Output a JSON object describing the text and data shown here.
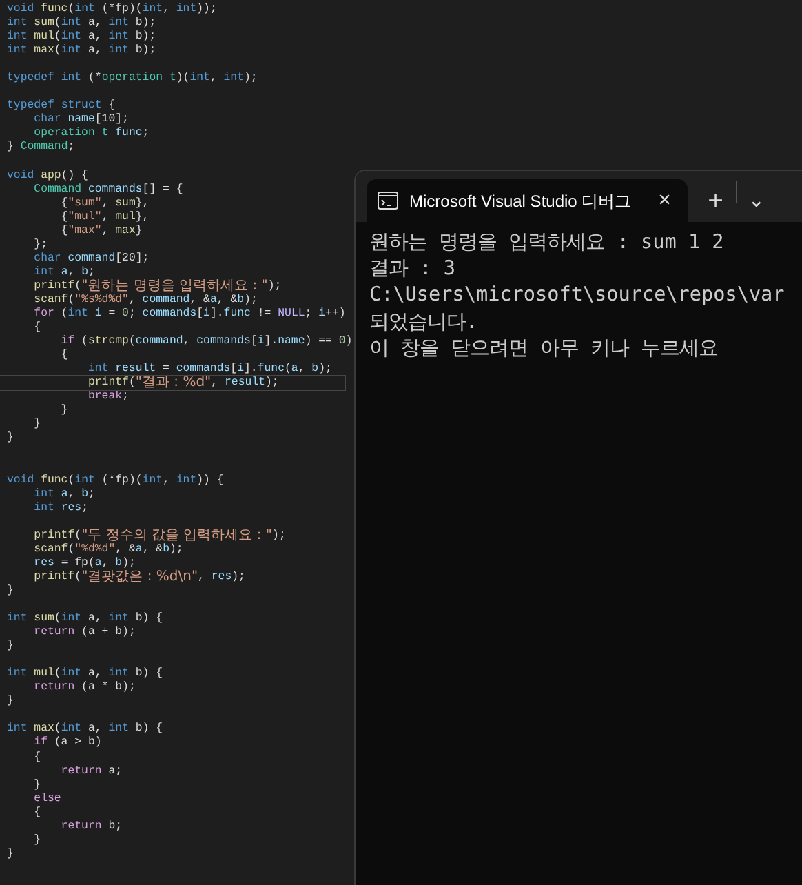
{
  "editor": {
    "code_lines": [
      {
        "current": false,
        "segments": [
          {
            "text": "void",
            "kind": "keyword"
          },
          {
            "text": " func",
            "kind": "function"
          },
          {
            "text": "(",
            "kind": "plain"
          },
          {
            "text": "int",
            "kind": "keyword"
          },
          {
            "text": " (*fp)(",
            "kind": "plain"
          },
          {
            "text": "int",
            "kind": "keyword"
          },
          {
            "text": ",",
            "kind": "plain"
          },
          {
            "text": " int",
            "kind": "keyword"
          },
          {
            "text": "));",
            "kind": "plain"
          }
        ]
      },
      {
        "current": false,
        "segments": [
          {
            "text": "int",
            "kind": "keyword"
          },
          {
            "text": " sum",
            "kind": "function"
          },
          {
            "text": "(",
            "kind": "plain"
          },
          {
            "text": "int",
            "kind": "keyword"
          },
          {
            "text": " a,",
            "kind": "plain"
          },
          {
            "text": " int",
            "kind": "keyword"
          },
          {
            "text": " b);",
            "kind": "plain"
          }
        ]
      },
      {
        "current": false,
        "segments": [
          {
            "text": "int",
            "kind": "keyword"
          },
          {
            "text": " mul",
            "kind": "function"
          },
          {
            "text": "(",
            "kind": "plain"
          },
          {
            "text": "int",
            "kind": "keyword"
          },
          {
            "text": " a,",
            "kind": "plain"
          },
          {
            "text": " int",
            "kind": "keyword"
          },
          {
            "text": " b);",
            "kind": "plain"
          }
        ]
      },
      {
        "current": false,
        "segments": [
          {
            "text": "int",
            "kind": "keyword"
          },
          {
            "text": " max",
            "kind": "function"
          },
          {
            "text": "(",
            "kind": "plain"
          },
          {
            "text": "int",
            "kind": "keyword"
          },
          {
            "text": " a,",
            "kind": "plain"
          },
          {
            "text": " int",
            "kind": "keyword"
          },
          {
            "text": " b);",
            "kind": "plain"
          }
        ]
      },
      {
        "current": false
      },
      {
        "current": false,
        "segments": [
          {
            "text": "typedef",
            "kind": "keyword"
          },
          {
            "text": " int",
            "kind": "keyword"
          },
          {
            "text": " (*",
            "kind": "plain"
          },
          {
            "text": "operation_t",
            "kind": "type"
          },
          {
            "text": ")(",
            "kind": "plain"
          },
          {
            "text": "int",
            "kind": "keyword"
          },
          {
            "text": ",",
            "kind": "plain"
          },
          {
            "text": " int",
            "kind": "keyword"
          },
          {
            "text": ");",
            "kind": "plain"
          }
        ]
      },
      {
        "current": false
      },
      {
        "current": false,
        "segments": [
          {
            "text": "typedef",
            "kind": "keyword"
          },
          {
            "text": " struct",
            "kind": "keyword"
          },
          {
            "text": " {",
            "kind": "plain"
          }
        ]
      },
      {
        "current": false,
        "segments": [
          {
            "text": "    char",
            "kind": "keyword"
          },
          {
            "text": " name",
            "kind": "variable"
          },
          {
            "text": "[10];",
            "kind": "plain"
          }
        ]
      },
      {
        "current": false,
        "segments": [
          {
            "text": "    operation_t",
            "kind": "type"
          },
          {
            "text": " func",
            "kind": "variable"
          },
          {
            "text": ";",
            "kind": "plain"
          }
        ]
      },
      {
        "current": false,
        "segments": [
          {
            "text": "}",
            "kind": "plain"
          },
          {
            "text": " Command",
            "kind": "type"
          },
          {
            "text": ";",
            "kind": "plain"
          }
        ]
      },
      {
        "current": false
      },
      {
        "current": false,
        "segments": [
          {
            "text": "void",
            "kind": "keyword"
          },
          {
            "text": " app",
            "kind": "function"
          },
          {
            "text": "() {",
            "kind": "plain"
          }
        ]
      },
      {
        "current": false,
        "segments": [
          {
            "text": "    Command",
            "kind": "type"
          },
          {
            "text": " commands",
            "kind": "variable"
          },
          {
            "text": "[] = {",
            "kind": "plain"
          }
        ]
      },
      {
        "current": false,
        "segments": [
          {
            "text": "        {",
            "kind": "plain"
          },
          {
            "text": "\"sum\"",
            "kind": "string"
          },
          {
            "text": ",",
            "kind": "plain"
          },
          {
            "text": " sum",
            "kind": "function"
          },
          {
            "text": "},",
            "kind": "plain"
          }
        ]
      },
      {
        "current": false,
        "segments": [
          {
            "text": "        {",
            "kind": "plain"
          },
          {
            "text": "\"mul\"",
            "kind": "string"
          },
          {
            "text": ",",
            "kind": "plain"
          },
          {
            "text": " mul",
            "kind": "function"
          },
          {
            "text": "},",
            "kind": "plain"
          }
        ]
      },
      {
        "current": false,
        "segments": [
          {
            "text": "        {",
            "kind": "plain"
          },
          {
            "text": "\"max\"",
            "kind": "string"
          },
          {
            "text": ",",
            "kind": "plain"
          },
          {
            "text": " max",
            "kind": "function"
          },
          {
            "text": "}",
            "kind": "plain"
          }
        ]
      },
      {
        "current": false,
        "segments": [
          {
            "text": "    };",
            "kind": "plain"
          }
        ]
      },
      {
        "current": false,
        "segments": [
          {
            "text": "    char",
            "kind": "keyword"
          },
          {
            "text": " command",
            "kind": "variable"
          },
          {
            "text": "[20];",
            "kind": "plain"
          }
        ]
      },
      {
        "current": false,
        "segments": [
          {
            "text": "    int",
            "kind": "keyword"
          },
          {
            "text": " a",
            "kind": "variable"
          },
          {
            "text": ",",
            "kind": "plain"
          },
          {
            "text": " b",
            "kind": "variable"
          },
          {
            "text": ";",
            "kind": "plain"
          }
        ]
      },
      {
        "current": false,
        "segments": [
          {
            "text": "    printf",
            "kind": "function"
          },
          {
            "text": "(",
            "kind": "plain"
          },
          {
            "text": "\"원하는 명령을 입력하세요 : \"",
            "kind": "string"
          },
          {
            "text": ");",
            "kind": "plain"
          }
        ]
      },
      {
        "current": false,
        "segments": [
          {
            "text": "    scanf",
            "kind": "function"
          },
          {
            "text": "(",
            "kind": "plain"
          },
          {
            "text": "\"%s%d%d\"",
            "kind": "string"
          },
          {
            "text": ",",
            "kind": "plain"
          },
          {
            "text": " command",
            "kind": "variable"
          },
          {
            "text": ", &",
            "kind": "plain"
          },
          {
            "text": "a",
            "kind": "variable"
          },
          {
            "text": ", &",
            "kind": "plain"
          },
          {
            "text": "b",
            "kind": "variable"
          },
          {
            "text": ");",
            "kind": "plain"
          }
        ]
      },
      {
        "current": false,
        "segments": [
          {
            "text": "    for",
            "kind": "control"
          },
          {
            "text": " (",
            "kind": "plain"
          },
          {
            "text": "int",
            "kind": "keyword"
          },
          {
            "text": " i",
            "kind": "variable"
          },
          {
            "text": " =",
            "kind": "plain"
          },
          {
            "text": " 0",
            "kind": "number"
          },
          {
            "text": ";",
            "kind": "plain"
          },
          {
            "text": " commands",
            "kind": "variable"
          },
          {
            "text": "[",
            "kind": "plain"
          },
          {
            "text": "i",
            "kind": "variable"
          },
          {
            "text": "].",
            "kind": "plain"
          },
          {
            "text": "func",
            "kind": "variable"
          },
          {
            "text": " !=",
            "kind": "plain"
          },
          {
            "text": " NULL",
            "kind": "macro"
          },
          {
            "text": ";",
            "kind": "plain"
          },
          {
            "text": " i",
            "kind": "variable"
          },
          {
            "text": "++)",
            "kind": "plain"
          }
        ]
      },
      {
        "current": false,
        "segments": [
          {
            "text": "    {",
            "kind": "plain"
          }
        ]
      },
      {
        "current": false,
        "segments": [
          {
            "text": "        if",
            "kind": "control"
          },
          {
            "text": " (",
            "kind": "plain"
          },
          {
            "text": "strcmp",
            "kind": "function"
          },
          {
            "text": "(",
            "kind": "plain"
          },
          {
            "text": "command",
            "kind": "variable"
          },
          {
            "text": ",",
            "kind": "plain"
          },
          {
            "text": " commands",
            "kind": "variable"
          },
          {
            "text": "[",
            "kind": "plain"
          },
          {
            "text": "i",
            "kind": "variable"
          },
          {
            "text": "].",
            "kind": "plain"
          },
          {
            "text": "name",
            "kind": "variable"
          },
          {
            "text": ") ==",
            "kind": "plain"
          },
          {
            "text": " 0",
            "kind": "number"
          },
          {
            "text": ")",
            "kind": "plain"
          }
        ]
      },
      {
        "current": false,
        "segments": [
          {
            "text": "        {",
            "kind": "plain"
          }
        ]
      },
      {
        "current": false,
        "segments": [
          {
            "text": "            int",
            "kind": "keyword"
          },
          {
            "text": " result",
            "kind": "variable"
          },
          {
            "text": " =",
            "kind": "plain"
          },
          {
            "text": " commands",
            "kind": "variable"
          },
          {
            "text": "[",
            "kind": "plain"
          },
          {
            "text": "i",
            "kind": "variable"
          },
          {
            "text": "].",
            "kind": "plain"
          },
          {
            "text": "func",
            "kind": "variable"
          },
          {
            "text": "(",
            "kind": "plain"
          },
          {
            "text": "a",
            "kind": "variable"
          },
          {
            "text": ",",
            "kind": "plain"
          },
          {
            "text": " b",
            "kind": "variable"
          },
          {
            "text": ");",
            "kind": "plain"
          }
        ]
      },
      {
        "current": true,
        "segments": [
          {
            "text": "            printf",
            "kind": "function"
          },
          {
            "text": "(",
            "kind": "plain"
          },
          {
            "text": "\"결과 : %d\"",
            "kind": "string"
          },
          {
            "text": ",",
            "kind": "plain"
          },
          {
            "text": " result",
            "kind": "variable"
          },
          {
            "text": ");",
            "kind": "plain"
          }
        ]
      },
      {
        "current": false,
        "segments": [
          {
            "text": "            break",
            "kind": "control"
          },
          {
            "text": ";",
            "kind": "plain"
          }
        ]
      },
      {
        "current": false,
        "segments": [
          {
            "text": "        }",
            "kind": "plain"
          }
        ]
      },
      {
        "current": false,
        "segments": [
          {
            "text": "    }",
            "kind": "plain"
          }
        ]
      },
      {
        "current": false,
        "segments": [
          {
            "text": "}",
            "kind": "plain"
          }
        ]
      },
      {
        "current": false
      },
      {
        "current": false
      },
      {
        "current": false,
        "segments": [
          {
            "text": "void",
            "kind": "keyword"
          },
          {
            "text": " func",
            "kind": "function"
          },
          {
            "text": "(",
            "kind": "plain"
          },
          {
            "text": "int",
            "kind": "keyword"
          },
          {
            "text": " (*fp)(",
            "kind": "plain"
          },
          {
            "text": "int",
            "kind": "keyword"
          },
          {
            "text": ",",
            "kind": "plain"
          },
          {
            "text": " int",
            "kind": "keyword"
          },
          {
            "text": ")) {",
            "kind": "plain"
          }
        ]
      },
      {
        "current": false,
        "segments": [
          {
            "text": "    int",
            "kind": "keyword"
          },
          {
            "text": " a",
            "kind": "variable"
          },
          {
            "text": ",",
            "kind": "plain"
          },
          {
            "text": " b",
            "kind": "variable"
          },
          {
            "text": ";",
            "kind": "plain"
          }
        ]
      },
      {
        "current": false,
        "segments": [
          {
            "text": "    int",
            "kind": "keyword"
          },
          {
            "text": " res",
            "kind": "variable"
          },
          {
            "text": ";",
            "kind": "plain"
          }
        ]
      },
      {
        "current": false
      },
      {
        "current": false,
        "segments": [
          {
            "text": "    printf",
            "kind": "function"
          },
          {
            "text": "(",
            "kind": "plain"
          },
          {
            "text": "\"두 정수의 값을 입력하세요 : \"",
            "kind": "string"
          },
          {
            "text": ");",
            "kind": "plain"
          }
        ]
      },
      {
        "current": false,
        "segments": [
          {
            "text": "    scanf",
            "kind": "function"
          },
          {
            "text": "(",
            "kind": "plain"
          },
          {
            "text": "\"%d%d\"",
            "kind": "string"
          },
          {
            "text": ", &",
            "kind": "plain"
          },
          {
            "text": "a",
            "kind": "variable"
          },
          {
            "text": ", &",
            "kind": "plain"
          },
          {
            "text": "b",
            "kind": "variable"
          },
          {
            "text": ");",
            "kind": "plain"
          }
        ]
      },
      {
        "current": false,
        "segments": [
          {
            "text": "    res",
            "kind": "variable"
          },
          {
            "text": " = fp(",
            "kind": "plain"
          },
          {
            "text": "a",
            "kind": "variable"
          },
          {
            "text": ",",
            "kind": "plain"
          },
          {
            "text": " b",
            "kind": "variable"
          },
          {
            "text": ");",
            "kind": "plain"
          }
        ]
      },
      {
        "current": false,
        "segments": [
          {
            "text": "    printf",
            "kind": "function"
          },
          {
            "text": "(",
            "kind": "plain"
          },
          {
            "text": "\"결괏값은 : %d\\n\"",
            "kind": "string"
          },
          {
            "text": ",",
            "kind": "plain"
          },
          {
            "text": " res",
            "kind": "variable"
          },
          {
            "text": ");",
            "kind": "plain"
          }
        ]
      },
      {
        "current": false,
        "segments": [
          {
            "text": "}",
            "kind": "plain"
          }
        ]
      },
      {
        "current": false
      },
      {
        "current": false,
        "segments": [
          {
            "text": "int",
            "kind": "keyword"
          },
          {
            "text": " sum",
            "kind": "function"
          },
          {
            "text": "(",
            "kind": "plain"
          },
          {
            "text": "int",
            "kind": "keyword"
          },
          {
            "text": " a,",
            "kind": "plain"
          },
          {
            "text": " int",
            "kind": "keyword"
          },
          {
            "text": " b) {",
            "kind": "plain"
          }
        ]
      },
      {
        "current": false,
        "segments": [
          {
            "text": "    return",
            "kind": "control"
          },
          {
            "text": " (a + b);",
            "kind": "plain"
          }
        ]
      },
      {
        "current": false,
        "segments": [
          {
            "text": "}",
            "kind": "plain"
          }
        ]
      },
      {
        "current": false
      },
      {
        "current": false,
        "segments": [
          {
            "text": "int",
            "kind": "keyword"
          },
          {
            "text": " mul",
            "kind": "function"
          },
          {
            "text": "(",
            "kind": "plain"
          },
          {
            "text": "int",
            "kind": "keyword"
          },
          {
            "text": " a,",
            "kind": "plain"
          },
          {
            "text": " int",
            "kind": "keyword"
          },
          {
            "text": " b) {",
            "kind": "plain"
          }
        ]
      },
      {
        "current": false,
        "segments": [
          {
            "text": "    return",
            "kind": "control"
          },
          {
            "text": " (a * b);",
            "kind": "plain"
          }
        ]
      },
      {
        "current": false,
        "segments": [
          {
            "text": "}",
            "kind": "plain"
          }
        ]
      },
      {
        "current": false
      },
      {
        "current": false,
        "segments": [
          {
            "text": "int",
            "kind": "keyword"
          },
          {
            "text": " max",
            "kind": "function"
          },
          {
            "text": "(",
            "kind": "plain"
          },
          {
            "text": "int",
            "kind": "keyword"
          },
          {
            "text": " a,",
            "kind": "plain"
          },
          {
            "text": " int",
            "kind": "keyword"
          },
          {
            "text": " b) {",
            "kind": "plain"
          }
        ]
      },
      {
        "current": false,
        "segments": [
          {
            "text": "    if",
            "kind": "control"
          },
          {
            "text": " (a > b)",
            "kind": "plain"
          }
        ]
      },
      {
        "current": false,
        "segments": [
          {
            "text": "    {",
            "kind": "plain"
          }
        ]
      },
      {
        "current": false,
        "segments": [
          {
            "text": "        return",
            "kind": "control"
          },
          {
            "text": " a;",
            "kind": "plain"
          }
        ]
      },
      {
        "current": false,
        "segments": [
          {
            "text": "    }",
            "kind": "plain"
          }
        ]
      },
      {
        "current": false,
        "segments": [
          {
            "text": "    else",
            "kind": "control"
          }
        ]
      },
      {
        "current": false,
        "segments": [
          {
            "text": "    {",
            "kind": "plain"
          }
        ]
      },
      {
        "current": false,
        "segments": [
          {
            "text": "        return",
            "kind": "control"
          },
          {
            "text": " b;",
            "kind": "plain"
          }
        ]
      },
      {
        "current": false,
        "segments": [
          {
            "text": "    }",
            "kind": "plain"
          }
        ]
      },
      {
        "current": false,
        "segments": [
          {
            "text": "}",
            "kind": "plain"
          }
        ]
      }
    ]
  },
  "terminal": {
    "tab": {
      "title": "Microsoft Visual Studio 디버그",
      "selected": true,
      "close": "×"
    },
    "new_tab": "+",
    "dropdown": "⌄",
    "output_lines": [
      "원하는 명령을 입력하세요 : sum 1 2",
      "결과 : 3",
      "C:\\Users\\microsoft\\source\\repos\\var",
      "되었습니다.",
      "이 창을 닫으려면 아무 키나 누르세요"
    ]
  }
}
